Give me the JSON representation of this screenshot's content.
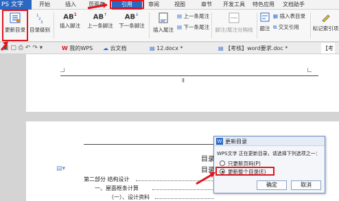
{
  "menubar": {
    "app_label": "PS 文字",
    "tabs": [
      "开始",
      "插入",
      "页面布",
      "引用",
      "审阅",
      "视图",
      "章节",
      "开发工具",
      "特色应用",
      "文档助手"
    ],
    "active_tab": "引用"
  },
  "ribbon": {
    "update_toc": "更新目录",
    "toc_level": "目录级别",
    "insert_footnote": "插入脚注",
    "prev_footnote": "上一条脚注",
    "next_footnote": "下一条脚注",
    "insert_endnote": "插入尾注",
    "prev_endnote": "上一条尾注",
    "next_endnote": "下一条尾注",
    "convert_note": "脚注/尾注分隔线",
    "caption": "题注",
    "insert_table_toc": "插入表目录",
    "cross_ref": "交叉引用",
    "mark_index": "标记索引项",
    "ab_label": "AB",
    "toc_icon_text": "1\n2\n3"
  },
  "tabs_row": {
    "tabs": [
      "我的WPS",
      "云文档",
      "12.docx *",
      "【考核】word要求.doc *",
      "【考"
    ]
  },
  "document": {
    "cursor_mark": "Ⅱ",
    "toc_heading": "目录",
    "toc_heading_2": "目录",
    "lines": [
      "第二部分  结构设计",
      "一、屋面框条计算",
      "（一）、设计资料"
    ]
  },
  "dialog": {
    "title": "更新目录",
    "message": "WPS文字 正在更新目录，请选择下列选项之一：",
    "option1": "只更新页码(P)",
    "option2": "更新整个目录(E)",
    "ok": "确定",
    "cancel": "取消"
  },
  "colors": {
    "accent_blue": "#2b68c2",
    "highlight_red": "#e0141c"
  }
}
